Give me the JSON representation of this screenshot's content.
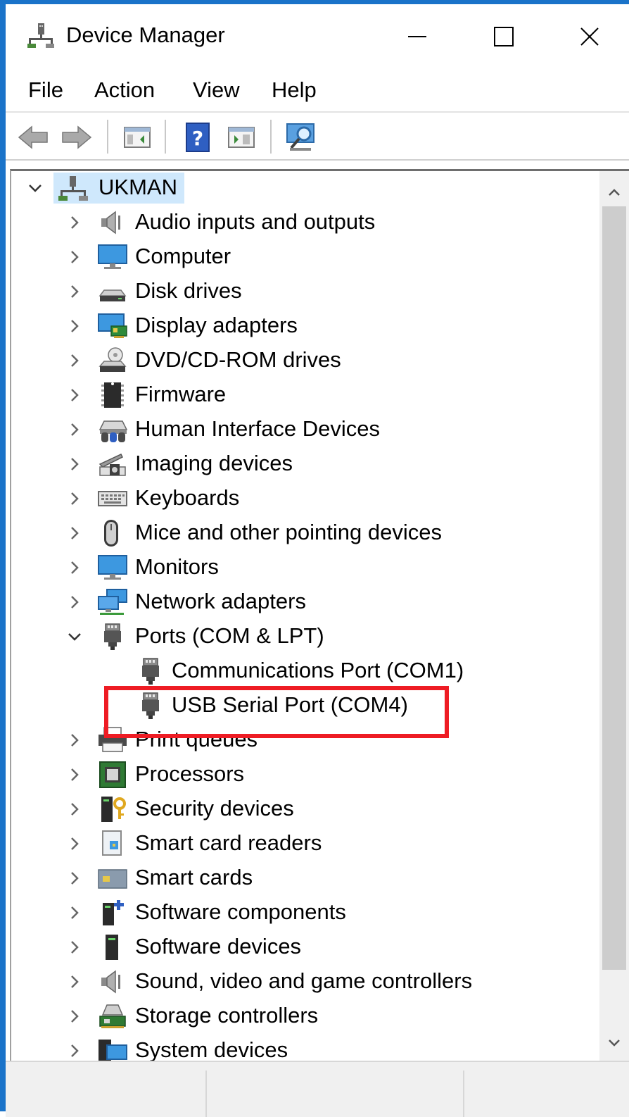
{
  "window": {
    "title": "Device Manager",
    "accent_color": "#1a73c9",
    "annotation_color": "#ee1c24"
  },
  "title_buttons": [
    {
      "name": "minimize-button",
      "icon": "minimize-icon"
    },
    {
      "name": "maximize-button",
      "icon": "maximize-icon"
    },
    {
      "name": "close-button",
      "icon": "close-icon"
    }
  ],
  "menu": [
    "File",
    "Action",
    "View",
    "Help"
  ],
  "toolbar": [
    "back-icon",
    "forward-icon",
    "properties-pane-icon",
    "help-icon",
    "update-driver-icon",
    "scan-hardware-icon"
  ],
  "tree": {
    "root": {
      "label": "UKMAN",
      "expanded": true,
      "selected": true,
      "icon": "computer-tree-icon"
    },
    "categories": [
      {
        "label": "Audio inputs and outputs",
        "icon": "speaker-icon",
        "expanded": false
      },
      {
        "label": "Computer",
        "icon": "monitor-icon",
        "expanded": false
      },
      {
        "label": "Disk drives",
        "icon": "disk-drive-icon",
        "expanded": false
      },
      {
        "label": "Display adapters",
        "icon": "display-adapter-icon",
        "expanded": false
      },
      {
        "label": "DVD/CD-ROM drives",
        "icon": "dvd-drive-icon",
        "expanded": false
      },
      {
        "label": "Firmware",
        "icon": "firmware-chip-icon",
        "expanded": false
      },
      {
        "label": "Human Interface Devices",
        "icon": "hid-icon",
        "expanded": false
      },
      {
        "label": "Imaging devices",
        "icon": "camera-icon",
        "expanded": false
      },
      {
        "label": "Keyboards",
        "icon": "keyboard-icon",
        "expanded": false
      },
      {
        "label": "Mice and other pointing devices",
        "icon": "mouse-icon",
        "expanded": false
      },
      {
        "label": "Monitors",
        "icon": "monitor-icon",
        "expanded": false
      },
      {
        "label": "Network adapters",
        "icon": "network-adapter-icon",
        "expanded": false
      },
      {
        "label": "Ports (COM & LPT)",
        "icon": "port-connector-icon",
        "expanded": true,
        "children": [
          {
            "label": "Communications Port (COM1)",
            "icon": "port-connector-icon"
          },
          {
            "label": "USB Serial Port (COM4)",
            "icon": "port-connector-icon",
            "highlighted": true
          }
        ]
      },
      {
        "label": "Print queues",
        "icon": "printer-icon",
        "expanded": false
      },
      {
        "label": "Processors",
        "icon": "processor-icon",
        "expanded": false
      },
      {
        "label": "Security devices",
        "icon": "security-key-icon",
        "expanded": false
      },
      {
        "label": "Smart card readers",
        "icon": "smart-card-reader-icon",
        "expanded": false
      },
      {
        "label": "Smart cards",
        "icon": "smart-card-icon",
        "expanded": false
      },
      {
        "label": "Software components",
        "icon": "software-component-icon",
        "expanded": false
      },
      {
        "label": "Software devices",
        "icon": "software-device-icon",
        "expanded": false
      },
      {
        "label": "Sound, video and game controllers",
        "icon": "speaker-icon",
        "expanded": false
      },
      {
        "label": "Storage controllers",
        "icon": "storage-controller-icon",
        "expanded": false
      },
      {
        "label": "System devices",
        "icon": "system-devices-icon",
        "expanded": false
      }
    ]
  }
}
